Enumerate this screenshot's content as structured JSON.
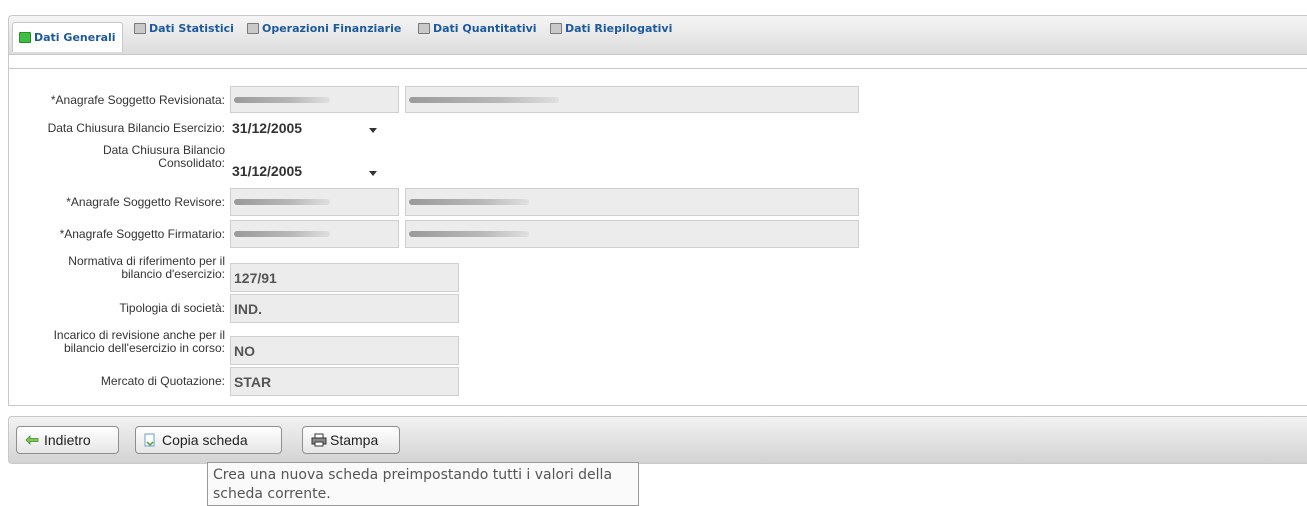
{
  "tabs": [
    {
      "label": "Dati Generali"
    },
    {
      "label": "Dati Statistici"
    },
    {
      "label": "Operazioni Finanziarie"
    },
    {
      "label": "Dati Quantitativi"
    },
    {
      "label": "Dati Riepilogativi"
    }
  ],
  "form": {
    "revisionata_label": "*Anagrafe Soggetto Revisionata:",
    "chiusura_esercizio_label": "Data Chiusura Bilancio Esercizio:",
    "chiusura_esercizio_value": "31/12/2005",
    "chiusura_consolidato_label_1": "Data Chiusura Bilancio",
    "chiusura_consolidato_label_2": "Consolidato:",
    "chiusura_consolidato_value": "31/12/2005",
    "revisore_label": "*Anagrafe Soggetto Revisore:",
    "firmatario_label": "*Anagrafe Soggetto Firmatario:",
    "normativa_label_1": "Normativa di riferimento per il",
    "normativa_label_2": "bilancio d'esercizio:",
    "normativa_value": "127/91",
    "tipologia_label": "Tipologia di società:",
    "tipologia_value": "IND.",
    "incarico_label_1": "Incarico di revisione anche per il",
    "incarico_label_2": "bilancio dell'esercizio in corso:",
    "incarico_value": "NO",
    "mercato_label": "Mercato di Quotazione:",
    "mercato_value": "STAR"
  },
  "buttons": {
    "indietro": "Indietro",
    "copia": "Copia scheda",
    "stampa": "Stampa"
  },
  "tooltip": {
    "line1": "Crea una nuova scheda preimpostando tutti i valori della",
    "line2": "scheda corrente."
  },
  "icons": {
    "tab_active": "green-tab-icon",
    "tab_inactive": "gray-tab-icon",
    "indietro": "back-arrow-icon",
    "copia": "copy-icon",
    "stampa": "printer-icon"
  }
}
